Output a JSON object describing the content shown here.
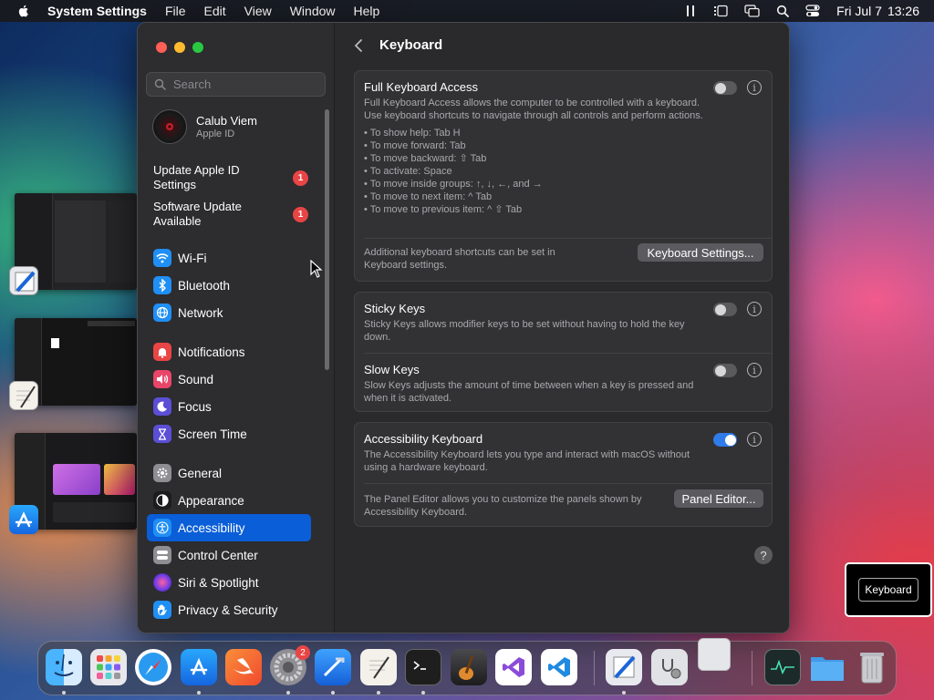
{
  "menubar": {
    "app_name": "System Settings",
    "items": [
      "File",
      "Edit",
      "View",
      "Window",
      "Help"
    ],
    "date": "Fri Jul 7",
    "time": "13:26"
  },
  "sidebar": {
    "search_placeholder": "Search",
    "profile": {
      "name": "Calub Viem",
      "subtitle": "Apple ID"
    },
    "notices": [
      {
        "label": "Update Apple ID Settings",
        "badge": "1"
      },
      {
        "label": "Software Update Available",
        "badge": "1"
      }
    ],
    "items": [
      {
        "label": "Wi-Fi",
        "icon": "wifi-icon",
        "color": "#1f8ff5"
      },
      {
        "label": "Bluetooth",
        "icon": "bluetooth-icon",
        "color": "#1f8ff5"
      },
      {
        "label": "Network",
        "icon": "globe-icon",
        "color": "#1f8ff5"
      },
      {
        "label": "Notifications",
        "icon": "bell-icon",
        "color": "#e94545"
      },
      {
        "label": "Sound",
        "icon": "speaker-icon",
        "color": "#e94569"
      },
      {
        "label": "Focus",
        "icon": "moon-icon",
        "color": "#5b4fd6"
      },
      {
        "label": "Screen Time",
        "icon": "hourglass-icon",
        "color": "#5b4fd6"
      },
      {
        "label": "General",
        "icon": "gear-icon",
        "color": "#8e8e93"
      },
      {
        "label": "Appearance",
        "icon": "appearance-icon",
        "color": "#1c1c1e"
      },
      {
        "label": "Accessibility",
        "icon": "accessibility-icon",
        "color": "#1f8ff5",
        "selected": true
      },
      {
        "label": "Control Center",
        "icon": "control-center-icon",
        "color": "#8e8e93"
      },
      {
        "label": "Siri & Spotlight",
        "icon": "siri-icon",
        "color": "#c33bd8"
      },
      {
        "label": "Privacy & Security",
        "icon": "hand-icon",
        "color": "#1f8ff5"
      }
    ]
  },
  "content": {
    "title": "Keyboard",
    "full_keyboard_access": {
      "title": "Full Keyboard Access",
      "description": "Full Keyboard Access allows the computer to be controlled with a keyboard. Use keyboard shortcuts to navigate through all controls and perform actions.",
      "enabled": false,
      "tips": [
        "• To show help: Tab H",
        "• To move forward: Tab",
        "• To move backward: ⇧ Tab",
        "• To activate: Space",
        "• To move inside groups: ↑, ↓, ←, and →",
        "• To move to next item: ^ Tab",
        "• To move to previous item: ^ ⇧ Tab"
      ],
      "footer": "Additional keyboard shortcuts can be set in Keyboard settings.",
      "button": "Keyboard Settings..."
    },
    "sticky_keys": {
      "title": "Sticky Keys",
      "description": "Sticky Keys allows modifier keys to be set without having to hold the key down.",
      "enabled": false
    },
    "slow_keys": {
      "title": "Slow Keys",
      "description": "Slow Keys adjusts the amount of time between when a key is pressed and when it is activated.",
      "enabled": false
    },
    "accessibility_keyboard": {
      "title": "Accessibility Keyboard",
      "description": "The Accessibility Keyboard lets you type and interact with macOS without using a hardware keyboard.",
      "enabled": true,
      "footer": "The Panel Editor allows you to customize the panels shown by Accessibility Keyboard.",
      "button": "Panel Editor..."
    },
    "help": "?"
  },
  "keyboard_tooltip": "Keyboard",
  "dock": {
    "system_settings_badge": "2"
  }
}
